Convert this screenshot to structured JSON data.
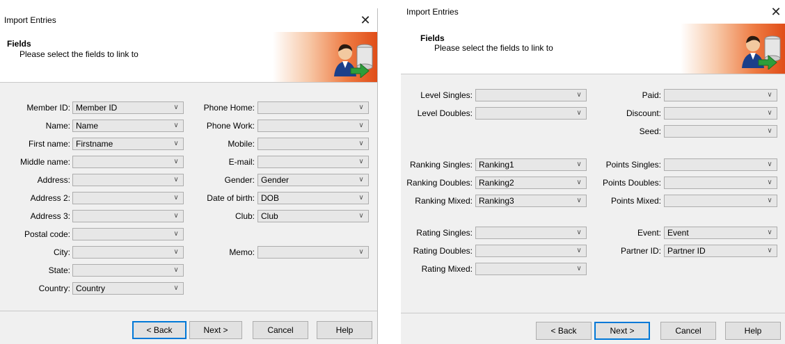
{
  "left": {
    "title": "Import Entries",
    "header": {
      "title": "Fields",
      "subtitle": "Please select the fields to link to"
    },
    "fields_col1": [
      {
        "label": "Member ID:",
        "value": "Member ID"
      },
      {
        "label": "Name:",
        "value": "Name"
      },
      {
        "label": "First name:",
        "value": "Firstname"
      },
      {
        "label": "Middle name:",
        "value": ""
      },
      {
        "label": "Address:",
        "value": ""
      },
      {
        "label": "Address 2:",
        "value": ""
      },
      {
        "label": "Address 3:",
        "value": ""
      },
      {
        "label": "Postal code:",
        "value": ""
      },
      {
        "label": "City:",
        "value": ""
      },
      {
        "label": "State:",
        "value": ""
      },
      {
        "label": "Country:",
        "value": "Country"
      }
    ],
    "fields_col2": [
      {
        "label": "Phone Home:",
        "value": ""
      },
      {
        "label": "Phone Work:",
        "value": ""
      },
      {
        "label": "Mobile:",
        "value": ""
      },
      {
        "label": "E-mail:",
        "value": ""
      },
      {
        "label": "Gender:",
        "value": "Gender"
      },
      {
        "label": "Date of birth:",
        "value": "DOB"
      },
      {
        "label": "Club:",
        "value": "Club"
      },
      {
        "label": "Memo:",
        "value": ""
      }
    ],
    "buttons": {
      "back": "< Back",
      "next": "Next >",
      "cancel": "Cancel",
      "help": "Help"
    }
  },
  "right": {
    "title": "Import Entries",
    "header": {
      "title": "Fields",
      "subtitle": "Please select the fields to link to"
    },
    "fields_col1": [
      {
        "label": "Level Singles:",
        "value": ""
      },
      {
        "label": "Level Doubles:",
        "value": ""
      },
      {
        "label": "Ranking Singles:",
        "value": "Ranking1"
      },
      {
        "label": "Ranking Doubles:",
        "value": "Ranking2"
      },
      {
        "label": "Ranking Mixed:",
        "value": "Ranking3"
      },
      {
        "label": "Rating Singles:",
        "value": ""
      },
      {
        "label": "Rating Doubles:",
        "value": ""
      },
      {
        "label": "Rating Mixed:",
        "value": ""
      }
    ],
    "fields_col2": [
      {
        "label": "Paid:",
        "value": ""
      },
      {
        "label": "Discount:",
        "value": ""
      },
      {
        "label": "Seed:",
        "value": ""
      },
      {
        "label": "Points Singles:",
        "value": ""
      },
      {
        "label": "Points Doubles:",
        "value": ""
      },
      {
        "label": "Points Mixed:",
        "value": ""
      },
      {
        "label": "Event:",
        "value": "Event"
      },
      {
        "label": "Partner ID:",
        "value": "Partner ID"
      }
    ],
    "buttons": {
      "back": "< Back",
      "next": "Next >",
      "cancel": "Cancel",
      "help": "Help"
    }
  },
  "icons": {
    "close": "close-icon",
    "logo": "user-database-import-icon",
    "dropdown": "chevron-down-icon"
  },
  "colors": {
    "banner_accent": "#e04d18",
    "focus_border": "#0078d7"
  }
}
